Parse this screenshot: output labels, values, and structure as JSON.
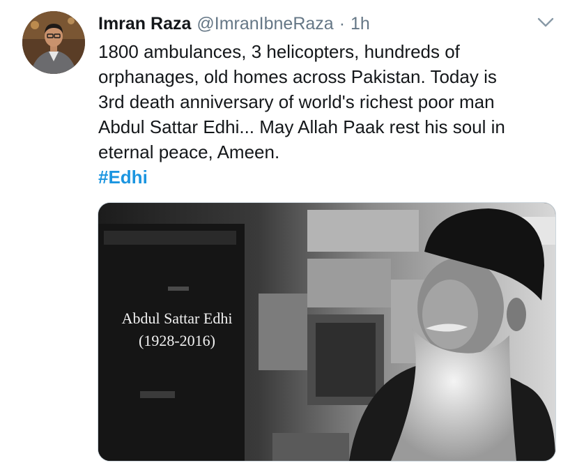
{
  "tweet": {
    "author": {
      "name": "Imran Raza",
      "handle": "@ImranIbneRaza",
      "separator": "·",
      "time": "1h"
    },
    "text_lines": [
      "1800 ambulances, 3 helicopters, hundreds of",
      "orphanages, old homes across Pakistan. Today is",
      "3rd death anniversary of world's richest poor man",
      "Abdul Sattar Edhi... May Allah Paak rest his soul in",
      "eternal peace, Ameen."
    ],
    "hashtag": "#Edhi",
    "media": {
      "caption_line1": "Abdul Sattar Edhi",
      "caption_line2": "(1928-2016)"
    },
    "icons": {
      "menu": "chevron-down-icon"
    },
    "colors": {
      "hashtag": "#1b95e0",
      "muted": "#657786",
      "text": "#14171a"
    }
  }
}
